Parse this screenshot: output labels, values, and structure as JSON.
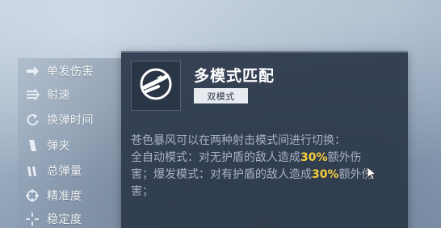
{
  "stats": [
    {
      "label": "单发伤害",
      "icon": "arrow-right-icon"
    },
    {
      "label": "射速",
      "icon": "fire-rate-icon"
    },
    {
      "label": "换弹时间",
      "icon": "reload-icon"
    },
    {
      "label": "弹夹",
      "icon": "magazine-icon"
    },
    {
      "label": "总弹量",
      "icon": "ammo-icon"
    },
    {
      "label": "精准度",
      "icon": "crosshair-icon"
    },
    {
      "label": "稳定度",
      "icon": "stability-icon"
    }
  ],
  "tooltip": {
    "title": "多模式匹配",
    "badge": "双模式",
    "desc_intro": "苍色暴风可以在两种射击模式间进行切换：",
    "line1_pre": "全自动模式：对无护盾的敌人造成",
    "line1_pct": "30%",
    "line1_post": "额外伤",
    "line2_pre": "害；爆发模式：对有护盾的敌人造成",
    "line2_pct": "30%",
    "line2_post": "额外伤",
    "line3": "害；"
  },
  "colors": {
    "highlight": "#f7cf3c",
    "panel": "#2c384a",
    "text_muted": "#a8b3c1"
  }
}
